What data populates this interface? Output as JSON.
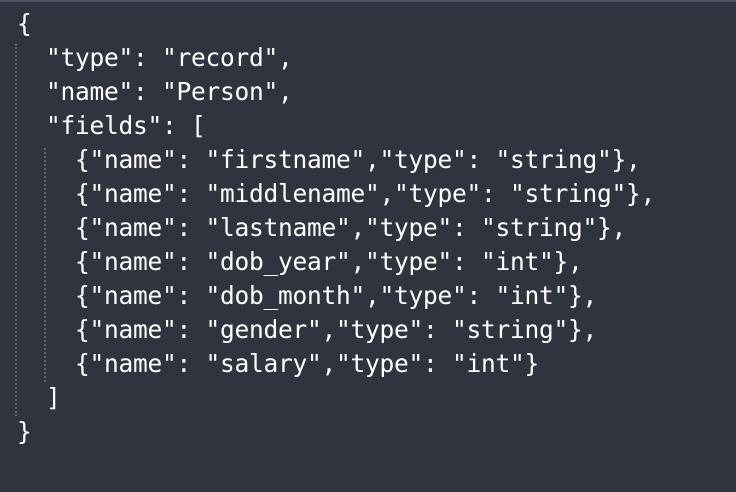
{
  "editor": {
    "lines": [
      "{",
      "  \"type\": \"record\",",
      "  \"name\": \"Person\",",
      "  \"fields\": [",
      "    {\"name\": \"firstname\",\"type\": \"string\"},",
      "    {\"name\": \"middlename\",\"type\": \"string\"},",
      "    {\"name\": \"lastname\",\"type\": \"string\"},",
      "    {\"name\": \"dob_year\",\"type\": \"int\"},",
      "    {\"name\": \"dob_month\",\"type\": \"int\"},",
      "    {\"name\": \"gender\",\"type\": \"string\"},",
      "    {\"name\": \"salary\",\"type\": \"int\"}",
      "  ]",
      "}"
    ],
    "colors": {
      "background": "#2f343e",
      "text": "#ffffff",
      "indent_guide": "#5c6270"
    }
  }
}
